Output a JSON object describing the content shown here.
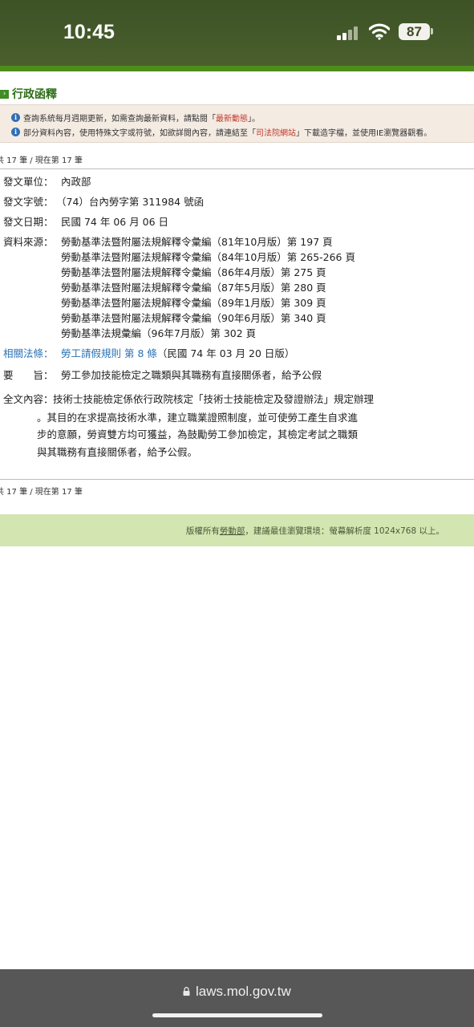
{
  "status": {
    "time": "10:45",
    "battery": "87"
  },
  "section": {
    "title": "行政函釋"
  },
  "notice": {
    "line1_pre": "查詢系統每月週期更新，如需查詢最新資料，請點閱「",
    "line1_link": "最新動態",
    "line1_post": "」。",
    "line2_pre": "部分資料內容，使用特殊文字或符號，如欲詳閱內容，請連結至「",
    "line2_link": "司法院網站",
    "line2_post": "」下載造字檔，並使用IE瀏覽器觀看。"
  },
  "count": {
    "text": "共 17 筆 / 現在第 17 筆"
  },
  "record": {
    "unit_label": "發文單位：",
    "unit_value": "內政部",
    "number_label": "發文字號：",
    "number_value": "（74）台內勞字第 311984 號函",
    "date_label": "發文日期：",
    "date_value": "民國 74 年 06 月 06 日",
    "source_label": "資料來源：",
    "sources": [
      "勞動基準法暨附屬法規解釋令彙編（81年10月版）第 197 頁",
      "勞動基準法暨附屬法規解釋令彙編（84年10月版）第 265-266 頁",
      "勞動基準法暨附屬法規解釋令彙編（86年4月版）第 275 頁",
      "勞動基準法暨附屬法規解釋令彙編（87年5月版）第 280 頁",
      "勞動基準法暨附屬法規解釋令彙編（89年1月版）第 309 頁",
      "勞動基準法暨附屬法規解釋令彙編（90年6月版）第 340 頁",
      "勞動基準法規彙編（96年7月版）第 302 頁"
    ],
    "related_label": "相關法條：",
    "related_link": "勞工請假規則 第 8 條",
    "related_date": "（民國 74 年 03 月 20 日版）",
    "gist_label": "要　　旨：",
    "gist_value": "勞工參加技能檢定之職類與其職務有直接關係者，給予公假",
    "full_label": "全文內容：",
    "full_lines": [
      "技術士技能檢定係依行政院核定「技術士技能檢定及發證辦法」規定辦理",
      "。其目的在求提高技術水準，建立職業證照制度，並可使勞工產生自求進",
      "步的意願，勞資雙方均可獲益，為鼓勵勞工參加檢定，其檢定考試之職類",
      "與其職務有直接關係者，給予公假。"
    ]
  },
  "footer": {
    "pre": "版權所有",
    "link": "勞動部",
    "post": "，建議最佳瀏覽環境：螢幕解析度 1024x768 以上。"
  },
  "browser": {
    "url": "laws.mol.gov.tw"
  }
}
